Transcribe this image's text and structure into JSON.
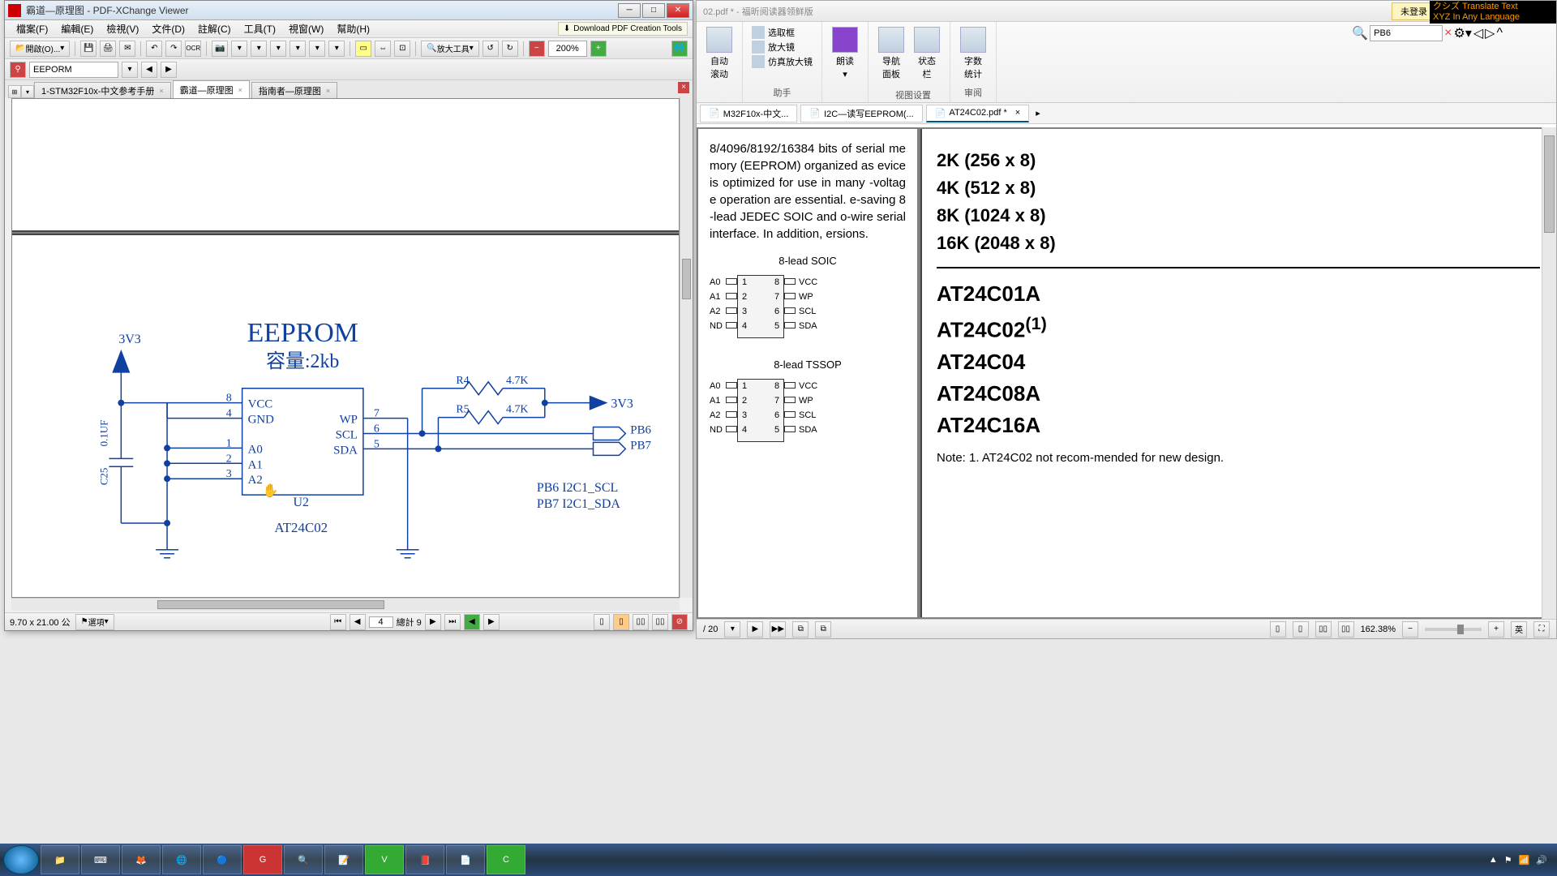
{
  "left": {
    "title": "霸道—原理图 - PDF-XChange Viewer",
    "menu": {
      "file": "檔案(F)",
      "edit": "編輯(E)",
      "view": "檢視(V)",
      "doc": "文件(D)",
      "comment": "註解(C)",
      "tool": "工具(T)",
      "window": "視窗(W)",
      "help": "幫助(H)"
    },
    "download_badge": "Download PDF Creation Tools",
    "toolbar": {
      "open": "開啟(O)...",
      "zoom_tool": "放大工具",
      "zoom_pct": "200%",
      "search_value": "EEPORM"
    },
    "tabs": [
      {
        "label": "1-STM32F10x-中文参考手册",
        "active": false
      },
      {
        "label": "霸道—原理图",
        "active": true
      },
      {
        "label": "指南者—原理图",
        "active": false
      }
    ],
    "schematic": {
      "title": "EEPROM",
      "subtitle": "容量:2kb",
      "supply": "3V3",
      "cap_val": "0.1UF",
      "cap_ref": "C25",
      "chip_ref": "U2",
      "chip_part": "AT24C02",
      "r4_ref": "R4",
      "r4_val": "4.7K",
      "r5_ref": "R5",
      "r5_val": "4.7K",
      "pins_left": [
        {
          "num": "8",
          "name": "VCC"
        },
        {
          "num": "4",
          "name": "GND"
        },
        {
          "num": "1",
          "name": "A0"
        },
        {
          "num": "2",
          "name": "A1"
        },
        {
          "num": "3",
          "name": "A2"
        }
      ],
      "pins_right": [
        {
          "num": "7",
          "name": "WP"
        },
        {
          "num": "6",
          "name": "SCL"
        },
        {
          "num": "5",
          "name": "SDA"
        }
      ],
      "net1": "PB6",
      "net2": "PB7",
      "map1": "PB6     I2C1_SCL",
      "map2": "PB7     I2C1_SDA",
      "out_supply": "3V3"
    },
    "status": {
      "dims": "9.70 x 21.00 公",
      "options": "選項",
      "page": "4",
      "total": "總計 9"
    }
  },
  "right": {
    "title_suffix": "02.pdf * - 福昕阅读器领鲜版",
    "login": "未登录",
    "search_value": "PB6",
    "ribbon": {
      "scroll": {
        "big": "自动\n滚动"
      },
      "select": {
        "a": "选取框",
        "b": "放大镜",
        "c": "仿真放大镜",
        "label": "助手"
      },
      "read": {
        "big": "朗读",
        "label": ""
      },
      "view": {
        "a": "导航\n面板",
        "b": "状态\n栏",
        "label": "视图设置"
      },
      "count": {
        "big": "字数\n统计",
        "label": "审阅"
      }
    },
    "doctabs": [
      {
        "label": "M32F10x-中文...",
        "active": false
      },
      {
        "label": "I2C—读写EEPROM(...",
        "active": false
      },
      {
        "label": "AT24C02.pdf *",
        "active": true
      }
    ],
    "translate": "クシズ Translate Text\nXYZ In Any Language",
    "left_page": {
      "para": "8/4096/8192/16384 bits of serial memory (EEPROM) organized as evice is optimized for use in many -voltage operation are essential. e-saving 8-lead JEDEC SOIC and o-wire serial interface. In addition, ersions.",
      "pkg1_title": "8-lead SOIC",
      "pkg2_title": "8-lead TSSOP",
      "pin_left": [
        "A0",
        "A1",
        "A2",
        "ND"
      ],
      "pin_right": [
        "VCC",
        "WP",
        "SCL",
        "SDA"
      ]
    },
    "right_page": {
      "sizes": [
        "2K (256 x 8)",
        "4K (512 x 8)",
        "8K (1024 x 8)",
        "16K (2048 x 8)"
      ],
      "parts": [
        "AT24C01A",
        "AT24C02",
        "AT24C04",
        "AT24C08A",
        "AT24C16A"
      ],
      "super": "(1)",
      "note": "Note:   1.   AT24C02 not recom-mended for new design."
    },
    "status": {
      "page_of": "/ 20",
      "zoom": "162.38%"
    }
  },
  "taskbar": {
    "items": [
      "📁",
      "⌨",
      "🦊",
      "🌐",
      "🔵",
      "G",
      "🔍",
      "📝",
      "V",
      "📕",
      "📄",
      "C"
    ]
  }
}
